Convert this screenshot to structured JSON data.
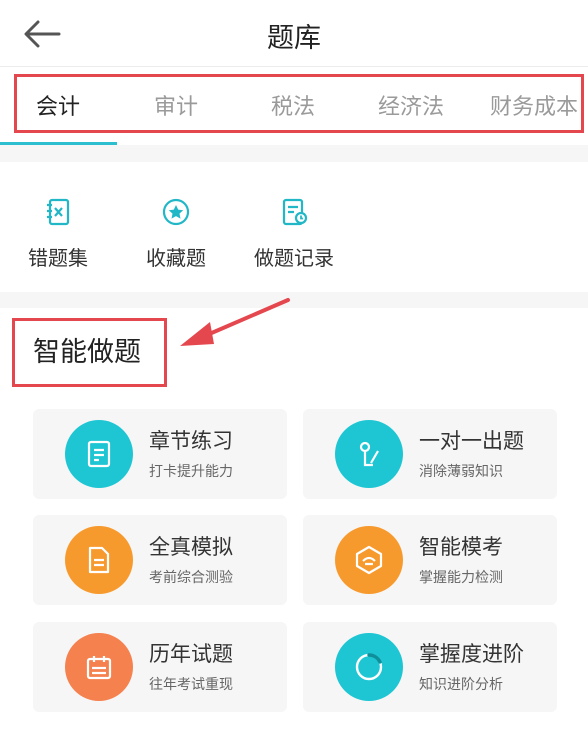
{
  "header": {
    "title": "题库",
    "back_icon": "arrow-left-icon"
  },
  "tabs": [
    {
      "label": "会计",
      "active": true
    },
    {
      "label": "审计",
      "active": false
    },
    {
      "label": "税法",
      "active": false
    },
    {
      "label": "经济法",
      "active": false
    },
    {
      "label": "财务成本",
      "active": false
    }
  ],
  "shortcuts": [
    {
      "label": "错题集",
      "icon": "wrong-book-icon"
    },
    {
      "label": "收藏题",
      "icon": "star-icon"
    },
    {
      "label": "做题记录",
      "icon": "record-icon"
    }
  ],
  "section": {
    "title": "智能做题",
    "cards": [
      {
        "name": "章节练习",
        "sub": "打卡提升能力",
        "icon": "document-icon",
        "color": "#1ec6d3"
      },
      {
        "name": "一对一出题",
        "sub": "消除薄弱知识",
        "icon": "one-on-one-icon",
        "color": "#1ec6d3"
      },
      {
        "name": "全真模拟",
        "sub": "考前综合测验",
        "icon": "paper-icon",
        "color": "#f79a2e"
      },
      {
        "name": "智能模考",
        "sub": "掌握能力检测",
        "icon": "smart-exam-icon",
        "color": "#f79a2e"
      },
      {
        "name": "历年试题",
        "sub": "往年考试重现",
        "icon": "calendar-icon",
        "color": "#f5814e"
      },
      {
        "name": "掌握度进阶",
        "sub": "知识进阶分析",
        "icon": "progress-ring-icon",
        "color": "#1ec6d3"
      }
    ]
  },
  "colors": {
    "accent": "#2bbfcf",
    "highlight": "#e5474f",
    "teal": "#1ec6d3",
    "orange": "#f79a2e",
    "coral": "#f5814e"
  }
}
